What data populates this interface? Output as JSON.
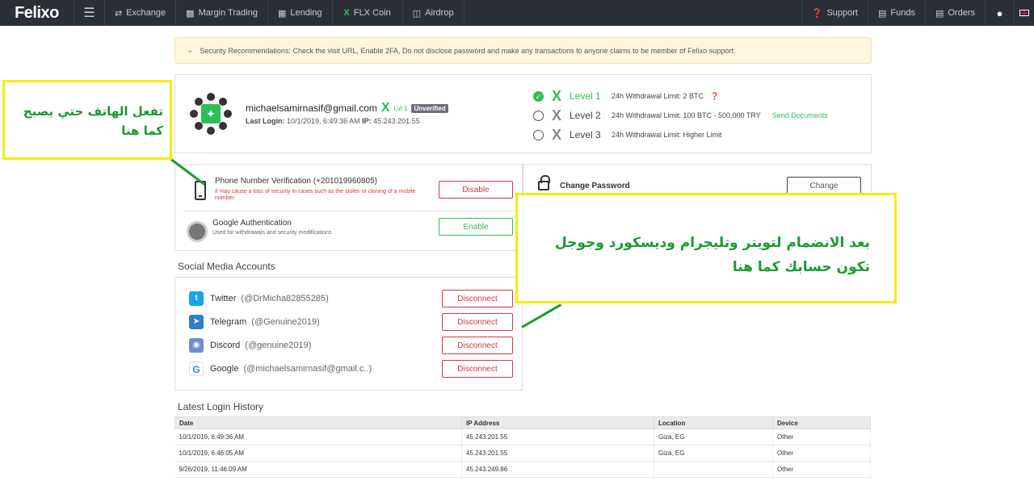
{
  "topbar": {
    "logo": "Felixo",
    "menu_icon": "menu-icon",
    "nav": [
      {
        "label": "Exchange",
        "icon": "exchange-icon"
      },
      {
        "label": "Margin Trading",
        "icon": "chart-icon"
      },
      {
        "label": "Lending",
        "icon": "lending-icon"
      },
      {
        "label": "FLX Coin",
        "icon": "flx-x-icon"
      },
      {
        "label": "Airdrop",
        "icon": "gift-icon"
      }
    ],
    "right": [
      {
        "label": "Support",
        "icon": "question-icon"
      },
      {
        "label": "Funds",
        "icon": "wallet-icon"
      },
      {
        "label": "Orders",
        "icon": "document-icon"
      }
    ]
  },
  "alert": {
    "text": "Security Recommendations: Check the visit URL, Enable 2FA, Do not disclose password and make any transactions to anyone claims to be member of Felixo support."
  },
  "profile": {
    "email": "michaelsamirnasif@gmail.com",
    "level_tag": "Lvl 1",
    "status_badge": "Unverified",
    "last_login_label": "Last Login:",
    "last_login_value": "10/1/2019, 6:49:36 AM",
    "ip_label": "IP:",
    "ip_value": "45.243.201.55",
    "levels": [
      {
        "name": "Level 1",
        "limit": "24h Withdrawal Limit: 2 BTC",
        "extra": ""
      },
      {
        "name": "Level 2",
        "limit": "24h Withdrawal Limit: 100 BTC - 500,000 TRY",
        "extra": "Send Documents"
      },
      {
        "name": "Level 3",
        "limit": "24h Withdrawal Limit: Higher Limit",
        "extra": ""
      }
    ]
  },
  "security": {
    "phone_title": "Phone Number Verification (+201019960805)",
    "phone_sub": "It may cause a loss of security in cases such as the stolen or cloning of a mobile number.",
    "phone_button": "Disable",
    "google_title": "Google Authentication",
    "google_sub": "Used for withdrawals and security modifications",
    "google_button": "Enable",
    "password_title": "Change Password",
    "password_button": "Change"
  },
  "social": {
    "title": "Social Media Accounts",
    "accounts": [
      {
        "name": "Twitter",
        "handle": "(@DrMicha82855285)",
        "button": "Disconnect",
        "color": "#1da1f2"
      },
      {
        "name": "Telegram",
        "handle": "(@Genuine2019)",
        "button": "Disconnect",
        "color": "#2f7fc1"
      },
      {
        "name": "Discord",
        "handle": "(@genuine2019)",
        "button": "Disconnect",
        "color": "#7289da"
      },
      {
        "name": "Google",
        "handle": "(@michaelsamirnasif@gmail.c..)",
        "button": "Disconnect",
        "color": "#4285f4"
      }
    ]
  },
  "history": {
    "title": "Latest Login History",
    "columns": [
      "Date",
      "IP Address",
      "Location",
      "Device"
    ],
    "rows": [
      [
        "10/1/2019, 6:49:36 AM",
        "45.243.201.55",
        "Giza, EG",
        "Other"
      ],
      [
        "10/1/2019, 6:46:05 AM",
        "45.243.201.55",
        "Giza, EG",
        "Other"
      ],
      [
        "9/26/2019, 11:46:09 AM",
        "45.243.249.86",
        "",
        "Other"
      ]
    ]
  },
  "annotations": {
    "note1": "تفعل الهاتف حتي يصبح كما هنا",
    "note2": "بعد الانضمام لتويتر وتليجرام وديسكورد وجوجل تكون حسابك كما هنا"
  }
}
